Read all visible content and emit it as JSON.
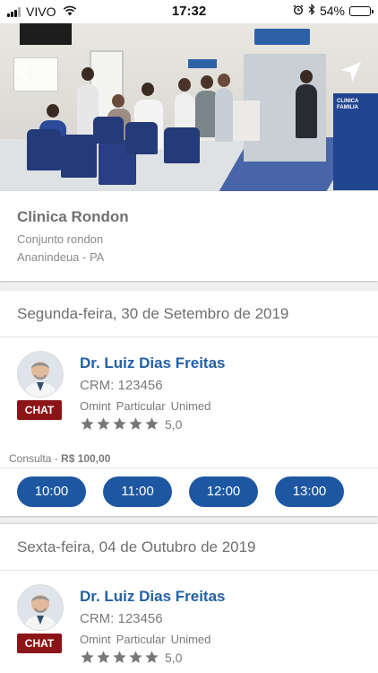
{
  "status_bar": {
    "carrier": "VIVO",
    "time": "17:32",
    "battery_percent": "54%",
    "battery_level": 0.54,
    "icons": [
      "signal-icon",
      "wifi-icon",
      "alarm-icon",
      "bluetooth-icon",
      "battery-icon"
    ]
  },
  "header": {
    "back_icon": "back-arrow-icon",
    "navigate_icon": "navigation-arrow-icon",
    "sign_text": "CLINICA FAMILIA"
  },
  "clinic": {
    "name": "Clinica Rondon",
    "address": "Conjunto rondon",
    "city": "Ananindeua - PA"
  },
  "days": [
    {
      "date": "Segunda-feira, 30 de Setembro de 2019",
      "doctor": {
        "name": "Dr. Luiz Dias Freitas",
        "crm": "CRM: 123456",
        "plans": [
          "Omint",
          "Particular",
          "Unimed"
        ],
        "rating": "5,0",
        "stars": 5,
        "chat_label": "CHAT"
      },
      "price_label": "Consulta - ",
      "price_value": "R$ 100,00",
      "slots": [
        "10:00",
        "11:00",
        "12:00",
        "13:00"
      ]
    },
    {
      "date": "Sexta-feira, 04 de Outubro de 2019",
      "doctor": {
        "name": "Dr. Luiz Dias Freitas",
        "crm": "CRM: 123456",
        "plans": [
          "Omint",
          "Particular",
          "Unimed"
        ],
        "rating": "5,0",
        "stars": 5,
        "chat_label": "CHAT"
      }
    }
  ],
  "colors": {
    "accent": "#1d57a2",
    "doctor_name": "#2360a5",
    "chat": "#8b1516",
    "star": "#777777"
  }
}
